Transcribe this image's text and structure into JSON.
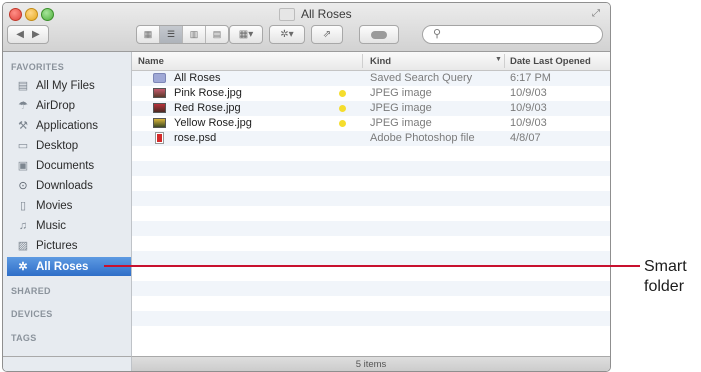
{
  "window": {
    "title": "All Roses"
  },
  "sidebar": {
    "favorites_header": "FAVORITES",
    "items": [
      {
        "label": "All My Files",
        "icon": "all-files-icon"
      },
      {
        "label": "AirDrop",
        "icon": "airdrop-icon"
      },
      {
        "label": "Applications",
        "icon": "applications-icon"
      },
      {
        "label": "Desktop",
        "icon": "desktop-icon"
      },
      {
        "label": "Documents",
        "icon": "documents-icon"
      },
      {
        "label": "Downloads",
        "icon": "downloads-icon"
      },
      {
        "label": "Movies",
        "icon": "movies-icon"
      },
      {
        "label": "Music",
        "icon": "music-icon"
      },
      {
        "label": "Pictures",
        "icon": "pictures-icon"
      },
      {
        "label": "All Roses",
        "icon": "gear-icon",
        "selected": true
      }
    ],
    "shared_header": "SHARED",
    "devices_header": "DEVICES",
    "tags_header": "TAGS"
  },
  "columns": {
    "name": "Name",
    "kind": "Kind",
    "date": "Date Last Opened"
  },
  "files": [
    {
      "name": "All Roses",
      "kind": "Saved Search Query",
      "date": "6:17 PM",
      "icon": "smart-folder-icon",
      "tag": false
    },
    {
      "name": "Pink Rose.jpg",
      "kind": "JPEG image",
      "date": "10/9/03",
      "icon": "image-file-icon",
      "tag": true
    },
    {
      "name": "Red Rose.jpg",
      "kind": "JPEG image",
      "date": "10/9/03",
      "icon": "image-file-icon",
      "tag": true
    },
    {
      "name": "Yellow Rose.jpg",
      "kind": "JPEG image",
      "date": "10/9/03",
      "icon": "image-file-icon",
      "tag": true
    },
    {
      "name": "rose.psd",
      "kind": "Adobe Photoshop file",
      "date": "4/8/07",
      "icon": "psd-file-icon",
      "tag": false
    }
  ],
  "tag_color": "#f5dd2d",
  "selection_color": "#2f6ec8",
  "callout_color": "#c8102e",
  "status": "5 items",
  "callout": {
    "line1": "Smart",
    "line2": "folder"
  }
}
